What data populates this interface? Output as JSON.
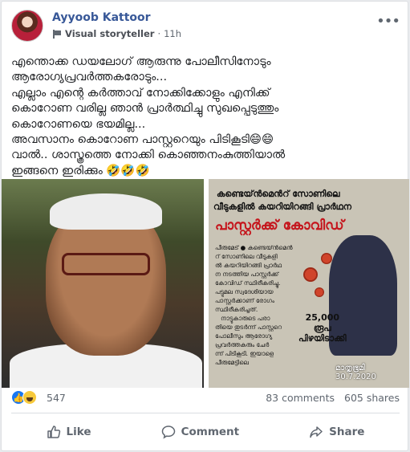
{
  "post": {
    "author": "Ayyoob Kattoor",
    "badge": "Visual storyteller",
    "separator": "·",
    "time": "11h",
    "more_glyph": "•••",
    "text_lines": [
      "എന്തൊക്ക ഡയലോഗ് ആരുന്നു പോലീസിനോടും",
      "ആരോഗ്യപ്രവർത്തകരോടും...",
      "എല്ലാം എന്റെ കർത്താവ് നോക്കിക്കോളും എനിക്ക്",
      "കൊറോണ വരില്ല ഞാൻ പ്രാർത്ഥിച്ചു സുഖപ്പെടുത്തും",
      "കൊറോണയെ ഭയമില്ല...",
      "അവസാനം കൊറോണ പാസ്റ്ററെയും പിടികൂടി😄😄",
      "വാൽ.. ശാസ്ത്രത്തെ നോക്കി കൊഞ്ഞനംകുത്തിയാൽ",
      "ഇങ്ങനെ ഇരിക്കും 🤣🤣🤣"
    ]
  },
  "clipping": {
    "line1": "കണ്ടെയ്ൻമെൻറ് സോണിലെ",
    "line2": "വീടുകളിൽ കയറിയിറങ്ങി പ്രാർഥന",
    "headline": "പാസ്റ്റർക്ക് കോവിഡ്",
    "body": "പീരുമേട് ● കണ്ടെയ്ൻമെൻ\nറ് സോണിലെ വീടുകളി\nൽ കയറിയിറങ്ങി പ്രാർഥ\nന നടത്തിയ പാസ്റ്റർക്ക്\nകോവിഡ് സ്ഥിരീകരിച്ചു.\nപട്ടുമല സ്വദേശിയായ\nപാസ്റ്റർക്കാണ് രോഗം\nസ്ഥിരീകരിച്ചത്.\n   നാട്ടുകാരുടെ പരാ\nതിയെ തുടർന്ന് പാസ്റ്ററെ\nപോലീസും ആരോഗ്യ\nപ്രവർത്തകരും ചേർ\nന്ന് പിടികൂടി. ഇയാളെ\nപീരുമേട്ടിലെ",
    "fine_amount": "25,000",
    "fine_line1": "രൂപ",
    "fine_line2": "പിഴയിടാക്കി",
    "source": "മാതൃഭൂമി",
    "date": "30.7.2020"
  },
  "stats": {
    "reaction_count": "547",
    "comments": "83 comments",
    "shares": "605 shares"
  },
  "actions": {
    "like": "Like",
    "comment": "Comment",
    "share": "Share"
  },
  "colors": {
    "brand": "#385898",
    "like_blue": "#1877f2",
    "headline_red": "#c5161d"
  }
}
